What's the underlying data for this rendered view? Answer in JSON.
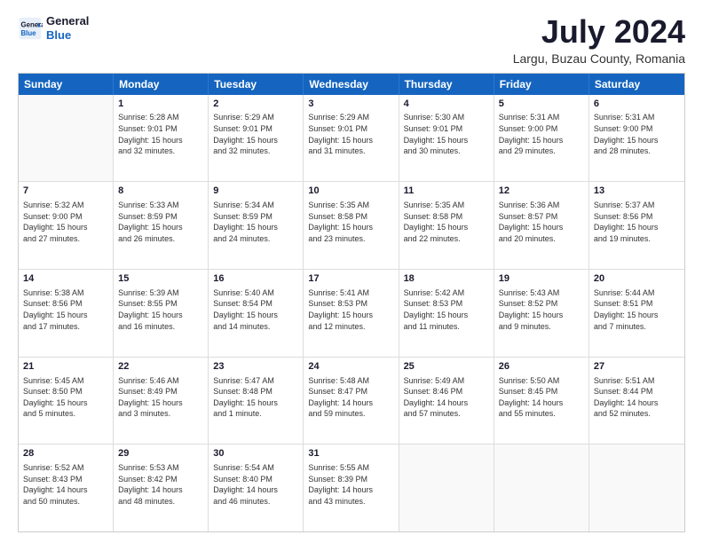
{
  "header": {
    "logo_general": "General",
    "logo_blue": "Blue",
    "main_title": "July 2024",
    "subtitle": "Largu, Buzau County, Romania"
  },
  "calendar": {
    "days": [
      "Sunday",
      "Monday",
      "Tuesday",
      "Wednesday",
      "Thursday",
      "Friday",
      "Saturday"
    ],
    "weeks": [
      [
        {
          "day": "",
          "content": ""
        },
        {
          "day": "1",
          "content": "Sunrise: 5:28 AM\nSunset: 9:01 PM\nDaylight: 15 hours\nand 32 minutes."
        },
        {
          "day": "2",
          "content": "Sunrise: 5:29 AM\nSunset: 9:01 PM\nDaylight: 15 hours\nand 32 minutes."
        },
        {
          "day": "3",
          "content": "Sunrise: 5:29 AM\nSunset: 9:01 PM\nDaylight: 15 hours\nand 31 minutes."
        },
        {
          "day": "4",
          "content": "Sunrise: 5:30 AM\nSunset: 9:01 PM\nDaylight: 15 hours\nand 30 minutes."
        },
        {
          "day": "5",
          "content": "Sunrise: 5:31 AM\nSunset: 9:00 PM\nDaylight: 15 hours\nand 29 minutes."
        },
        {
          "day": "6",
          "content": "Sunrise: 5:31 AM\nSunset: 9:00 PM\nDaylight: 15 hours\nand 28 minutes."
        }
      ],
      [
        {
          "day": "7",
          "content": "Sunrise: 5:32 AM\nSunset: 9:00 PM\nDaylight: 15 hours\nand 27 minutes."
        },
        {
          "day": "8",
          "content": "Sunrise: 5:33 AM\nSunset: 8:59 PM\nDaylight: 15 hours\nand 26 minutes."
        },
        {
          "day": "9",
          "content": "Sunrise: 5:34 AM\nSunset: 8:59 PM\nDaylight: 15 hours\nand 24 minutes."
        },
        {
          "day": "10",
          "content": "Sunrise: 5:35 AM\nSunset: 8:58 PM\nDaylight: 15 hours\nand 23 minutes."
        },
        {
          "day": "11",
          "content": "Sunrise: 5:35 AM\nSunset: 8:58 PM\nDaylight: 15 hours\nand 22 minutes."
        },
        {
          "day": "12",
          "content": "Sunrise: 5:36 AM\nSunset: 8:57 PM\nDaylight: 15 hours\nand 20 minutes."
        },
        {
          "day": "13",
          "content": "Sunrise: 5:37 AM\nSunset: 8:56 PM\nDaylight: 15 hours\nand 19 minutes."
        }
      ],
      [
        {
          "day": "14",
          "content": "Sunrise: 5:38 AM\nSunset: 8:56 PM\nDaylight: 15 hours\nand 17 minutes."
        },
        {
          "day": "15",
          "content": "Sunrise: 5:39 AM\nSunset: 8:55 PM\nDaylight: 15 hours\nand 16 minutes."
        },
        {
          "day": "16",
          "content": "Sunrise: 5:40 AM\nSunset: 8:54 PM\nDaylight: 15 hours\nand 14 minutes."
        },
        {
          "day": "17",
          "content": "Sunrise: 5:41 AM\nSunset: 8:53 PM\nDaylight: 15 hours\nand 12 minutes."
        },
        {
          "day": "18",
          "content": "Sunrise: 5:42 AM\nSunset: 8:53 PM\nDaylight: 15 hours\nand 11 minutes."
        },
        {
          "day": "19",
          "content": "Sunrise: 5:43 AM\nSunset: 8:52 PM\nDaylight: 15 hours\nand 9 minutes."
        },
        {
          "day": "20",
          "content": "Sunrise: 5:44 AM\nSunset: 8:51 PM\nDaylight: 15 hours\nand 7 minutes."
        }
      ],
      [
        {
          "day": "21",
          "content": "Sunrise: 5:45 AM\nSunset: 8:50 PM\nDaylight: 15 hours\nand 5 minutes."
        },
        {
          "day": "22",
          "content": "Sunrise: 5:46 AM\nSunset: 8:49 PM\nDaylight: 15 hours\nand 3 minutes."
        },
        {
          "day": "23",
          "content": "Sunrise: 5:47 AM\nSunset: 8:48 PM\nDaylight: 15 hours\nand 1 minute."
        },
        {
          "day": "24",
          "content": "Sunrise: 5:48 AM\nSunset: 8:47 PM\nDaylight: 14 hours\nand 59 minutes."
        },
        {
          "day": "25",
          "content": "Sunrise: 5:49 AM\nSunset: 8:46 PM\nDaylight: 14 hours\nand 57 minutes."
        },
        {
          "day": "26",
          "content": "Sunrise: 5:50 AM\nSunset: 8:45 PM\nDaylight: 14 hours\nand 55 minutes."
        },
        {
          "day": "27",
          "content": "Sunrise: 5:51 AM\nSunset: 8:44 PM\nDaylight: 14 hours\nand 52 minutes."
        }
      ],
      [
        {
          "day": "28",
          "content": "Sunrise: 5:52 AM\nSunset: 8:43 PM\nDaylight: 14 hours\nand 50 minutes."
        },
        {
          "day": "29",
          "content": "Sunrise: 5:53 AM\nSunset: 8:42 PM\nDaylight: 14 hours\nand 48 minutes."
        },
        {
          "day": "30",
          "content": "Sunrise: 5:54 AM\nSunset: 8:40 PM\nDaylight: 14 hours\nand 46 minutes."
        },
        {
          "day": "31",
          "content": "Sunrise: 5:55 AM\nSunset: 8:39 PM\nDaylight: 14 hours\nand 43 minutes."
        },
        {
          "day": "",
          "content": ""
        },
        {
          "day": "",
          "content": ""
        },
        {
          "day": "",
          "content": ""
        }
      ]
    ]
  }
}
